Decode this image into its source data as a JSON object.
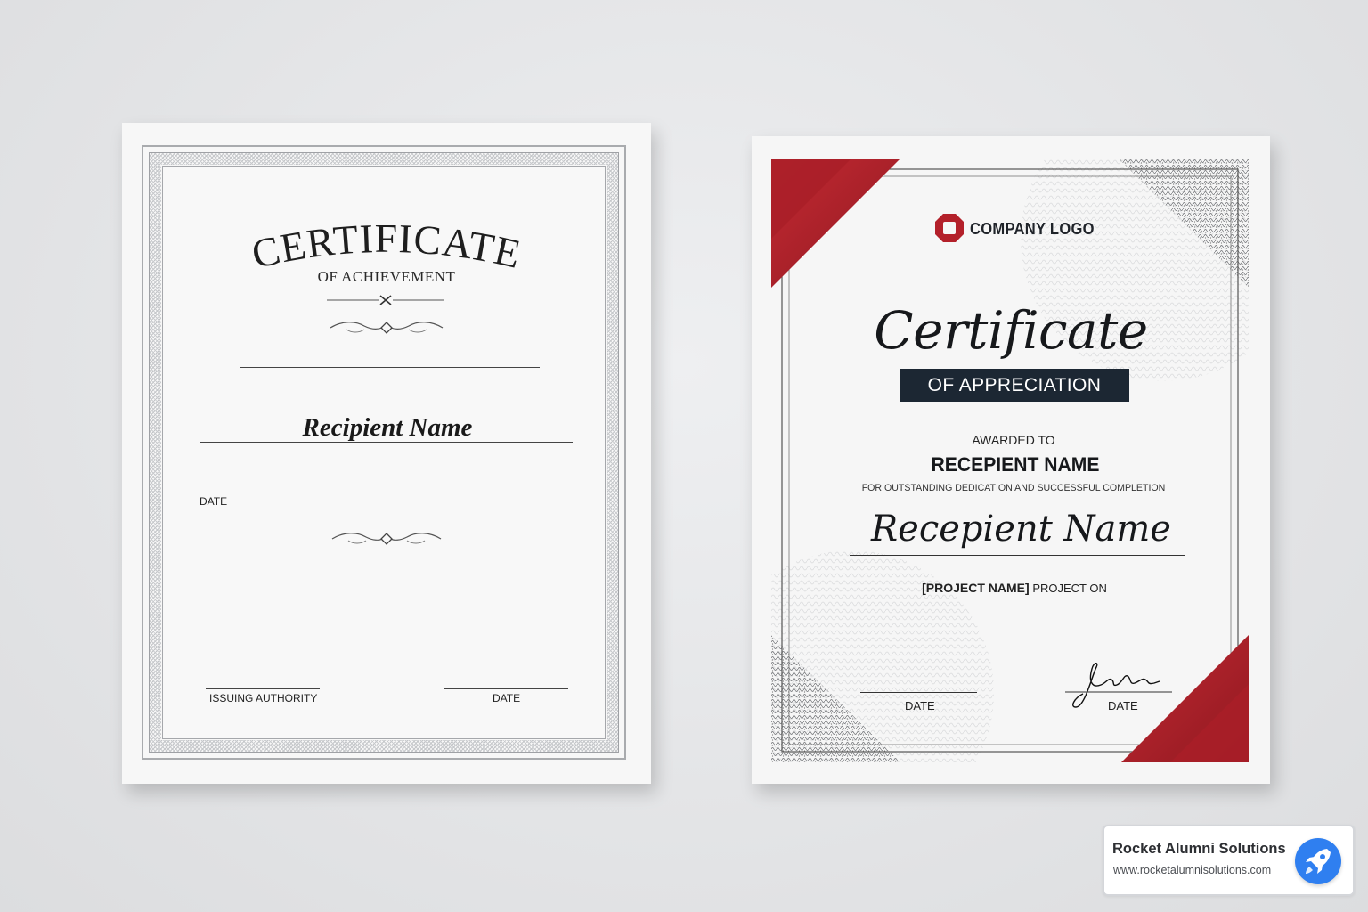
{
  "left_certificate": {
    "title": "CERTIFICATE",
    "subtitle": "OF ACHIEVEMENT",
    "recipient": "Recipient Name",
    "date_label": "DATE",
    "issuing_label": "ISSUING AUTHORITY",
    "date_label_2": "DATE"
  },
  "right_certificate": {
    "logo_text": "COMPANY LOGO",
    "title": "Certificate",
    "subtitle": "OF APPRECIATION",
    "awarded_to": "AWARDED TO",
    "recipient_caps": "RECEPIENT NAME",
    "description": "FOR OUTSTANDING DEDICATION AND SUCCESSFUL COMPLETION",
    "recipient_script": "Recepient Name",
    "project_name": "[PROJECT NAME]",
    "project_suffix": "PROJECT ON",
    "date_left": "DATE",
    "date_right": "DATE",
    "accent_color": "#b3202a",
    "band_color": "#1c2733"
  },
  "badge": {
    "title": "Rocket Alumni Solutions",
    "url": "www.rocketalumnisolutions.com",
    "icon": "rocket-icon",
    "icon_color": "#2f7ff0"
  }
}
